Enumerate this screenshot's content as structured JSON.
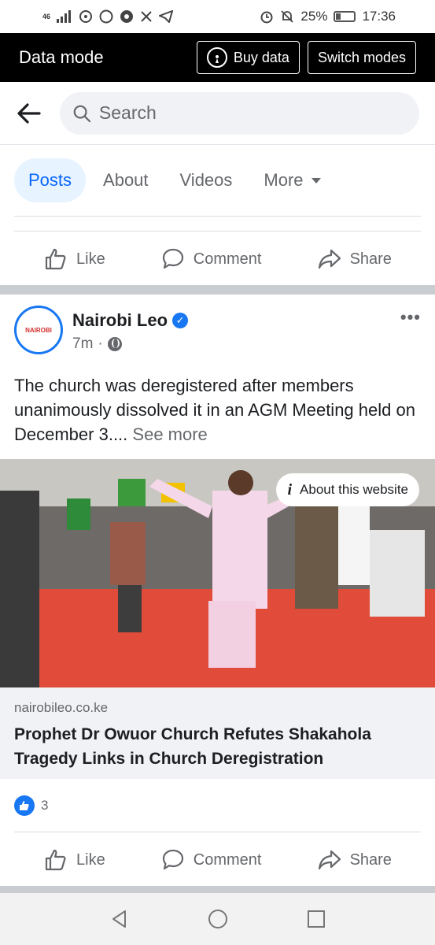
{
  "status_bar": {
    "signal": "46",
    "battery": "25%",
    "time": "17:36"
  },
  "data_mode_bar": {
    "title": "Data mode",
    "buy_data_label": "Buy data",
    "switch_modes_label": "Switch modes"
  },
  "search": {
    "placeholder": "Search"
  },
  "tabs": [
    {
      "label": "Posts",
      "active": true
    },
    {
      "label": "About",
      "active": false
    },
    {
      "label": "Videos",
      "active": false
    },
    {
      "label": "More",
      "active": false
    }
  ],
  "actions": {
    "like_label": "Like",
    "comment_label": "Comment",
    "share_label": "Share"
  },
  "post": {
    "page_name": "Nairobi Leo",
    "avatar_text": "NAIROBI",
    "time": "7m",
    "text": "The church was deregistered after members unanimously dissolved it in an AGM Meeting held on December 3....",
    "see_more": "See more",
    "about_website": "About this website",
    "link_domain": "nairobileo.co.ke",
    "link_title": "Prophet Dr Owuor Church Refutes Shakahola Tragedy Links in Church Deregistration",
    "reaction_count": "3"
  },
  "colors": {
    "accent": "#0866ff",
    "brand_blue": "#1877f2",
    "muted_text": "#65676b"
  }
}
